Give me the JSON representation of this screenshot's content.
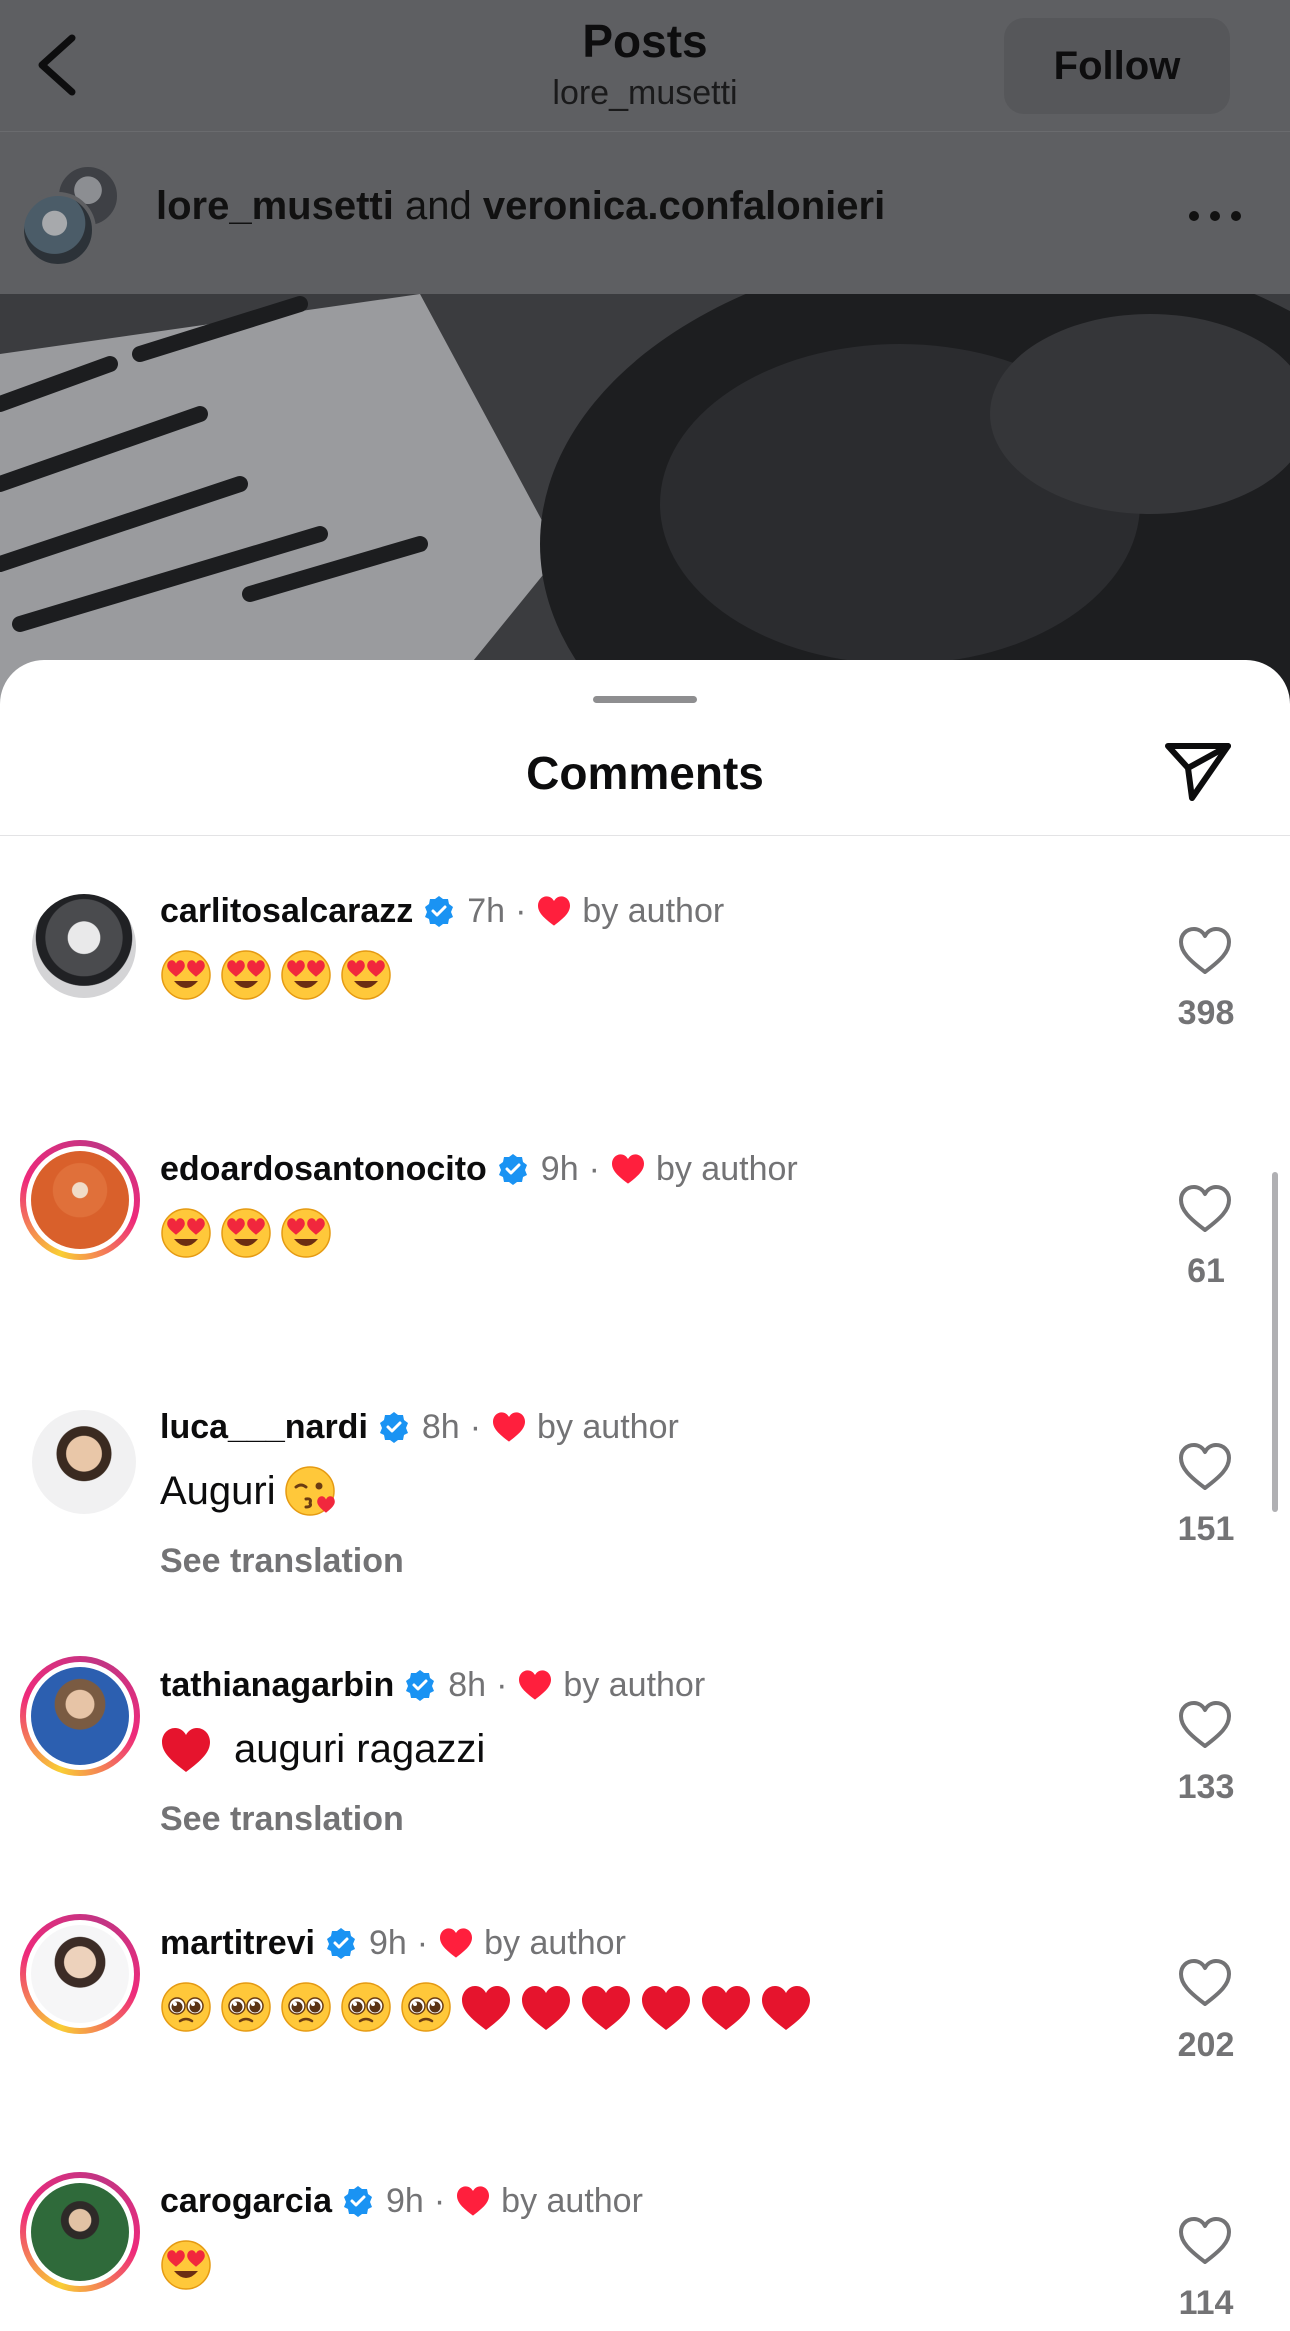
{
  "header": {
    "title": "Posts",
    "subtitle": "lore_musetti",
    "follow_label": "Follow"
  },
  "post": {
    "author_one": "lore_musetti",
    "connector": "and",
    "author_two": "veronica.confalonieri"
  },
  "sheet": {
    "title": "Comments"
  },
  "comments": [
    {
      "username": "carlitosalcarazz",
      "time": "7h",
      "liked_by": "by author",
      "text": "",
      "emojis": [
        "heart-eyes",
        "heart-eyes",
        "heart-eyes",
        "heart-eyes"
      ],
      "likes": "398",
      "translation": ""
    },
    {
      "username": "edoardosantonocito",
      "time": "9h",
      "liked_by": "by author",
      "text": "",
      "emojis": [
        "heart-eyes",
        "heart-eyes",
        "heart-eyes"
      ],
      "likes": "61",
      "translation": ""
    },
    {
      "username": "luca___nardi",
      "time": "8h",
      "liked_by": "by author",
      "text": "Auguri",
      "emojis": [
        "kiss-face"
      ],
      "likes": "151",
      "translation": "See translation"
    },
    {
      "username": "tathianagarbin",
      "time": "8h",
      "liked_by": "by author",
      "text": "auguri ragazzi",
      "emojis": [
        "red-heart"
      ],
      "likes": "133",
      "translation": "See translation"
    },
    {
      "username": "martitrevi",
      "time": "9h",
      "liked_by": "by author",
      "text": "",
      "emojis": [
        "pleading-face",
        "pleading-face",
        "pleading-face",
        "pleading-face",
        "pleading-face",
        "red-heart",
        "red-heart",
        "red-heart",
        "red-heart",
        "red-heart",
        "red-heart"
      ],
      "likes": "202",
      "translation": ""
    },
    {
      "username": "carogarcia",
      "time": "9h",
      "liked_by": "by author",
      "text": "",
      "emojis": [
        "heart-eyes"
      ],
      "likes": "114",
      "translation": ""
    }
  ],
  "icons": {
    "back": "chevron-left-icon",
    "more": "more-horizontal-icon",
    "share": "send-icon",
    "verified": "verified-badge-icon",
    "like": "heart-outline-icon"
  },
  "colors": {
    "verified": "#1a93f3",
    "heart": "#ff1f3d",
    "muted_text": "#737375"
  }
}
